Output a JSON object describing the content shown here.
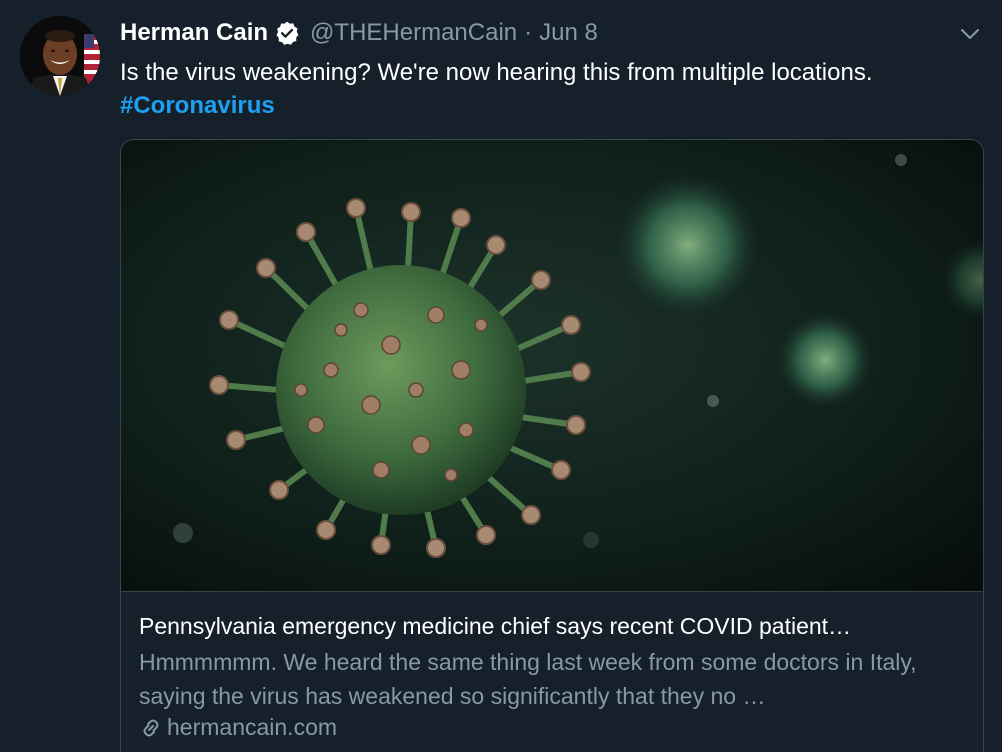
{
  "tweet": {
    "author_name": "Herman Cain",
    "handle": "@THEHermanCain",
    "separator": "·",
    "date": "Jun 8",
    "text": "Is the virus weakening? We're now hearing this from multiple locations.",
    "hashtag": "#Coronavirus"
  },
  "card": {
    "title": "Pennsylvania emergency medicine chief says recent COVID patient…",
    "description": "Hmmmmmm. We heard the same thing last week from some doctors in Italy, saying the virus has weakened so significantly that they no …",
    "domain": "hermancain.com"
  },
  "colors": {
    "background": "#15202b",
    "accent": "#1da1f2",
    "secondary_text": "#8899a6",
    "border": "#38444d"
  },
  "icons": {
    "verified": "verified-badge-icon",
    "caret": "chevron-down-icon",
    "link": "link-icon"
  }
}
